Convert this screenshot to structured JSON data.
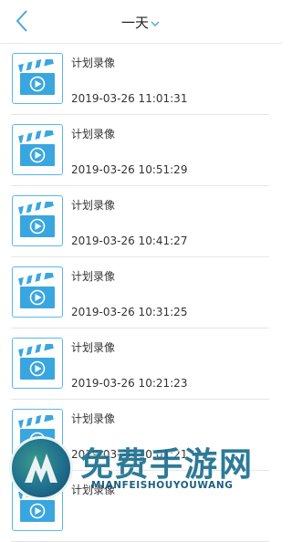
{
  "header": {
    "back_icon": "chevron-left-icon",
    "title": "一天",
    "dropdown_icon": "chevron-down-icon",
    "accent": "#4aa8d8"
  },
  "recordings": [
    {
      "name": "计划录像",
      "time": "2019-03-26 11:01:31"
    },
    {
      "name": "计划录像",
      "time": "2019-03-26 10:51:29"
    },
    {
      "name": "计划录像",
      "time": "2019-03-26 10:41:27"
    },
    {
      "name": "计划录像",
      "time": "2019-03-26 10:31:25"
    },
    {
      "name": "计划录像",
      "time": "2019-03-26 10:21:23"
    },
    {
      "name": "计划录像",
      "time": "2019-03-26 10:01:21"
    },
    {
      "name": "计划录像",
      "time": ""
    }
  ],
  "thumbnail_icon": "clapperboard-play-icon",
  "watermark": {
    "title": "免费手游网",
    "subtitle": "MIANFEISHOUYOUWANG"
  }
}
